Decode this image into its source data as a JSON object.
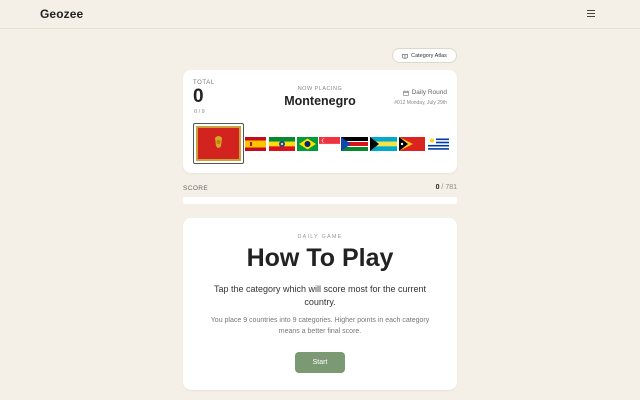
{
  "app": {
    "logo": "Geozee"
  },
  "header": {
    "menu_icon": "hamburger-icon"
  },
  "atlas": {
    "label": "Category Atlas",
    "icon": "book-icon"
  },
  "game": {
    "total_label": "TOTAL",
    "total_value": "0",
    "placed_fraction": "0 / 9",
    "now_placing_label": "NOW PLACING",
    "country": "Montenegro",
    "round_label": "Daily Round",
    "round_icon": "calendar-icon",
    "round_date": "#012 Monday, July 29th",
    "current_flag": "flag-montenegro",
    "upcoming_flags": [
      "flag-spain",
      "flag-ethiopia",
      "flag-brazil",
      "flag-singapore",
      "flag-south-sudan",
      "flag-bahamas",
      "flag-east-timor",
      "flag-uruguay"
    ]
  },
  "score": {
    "label": "SCORE",
    "value": "0",
    "max": " / 781",
    "progress": 0
  },
  "how_to_play": {
    "eyebrow": "DAILY GAME",
    "title": "How To Play",
    "text1": "Tap the category which will score most for the current country.",
    "text2": "You place 9 countries into 9 categories. Higher points in each category means a better final score.",
    "start_label": "Start"
  },
  "colors": {
    "background": "#f5f0e7",
    "accent": "#7b9a74"
  }
}
